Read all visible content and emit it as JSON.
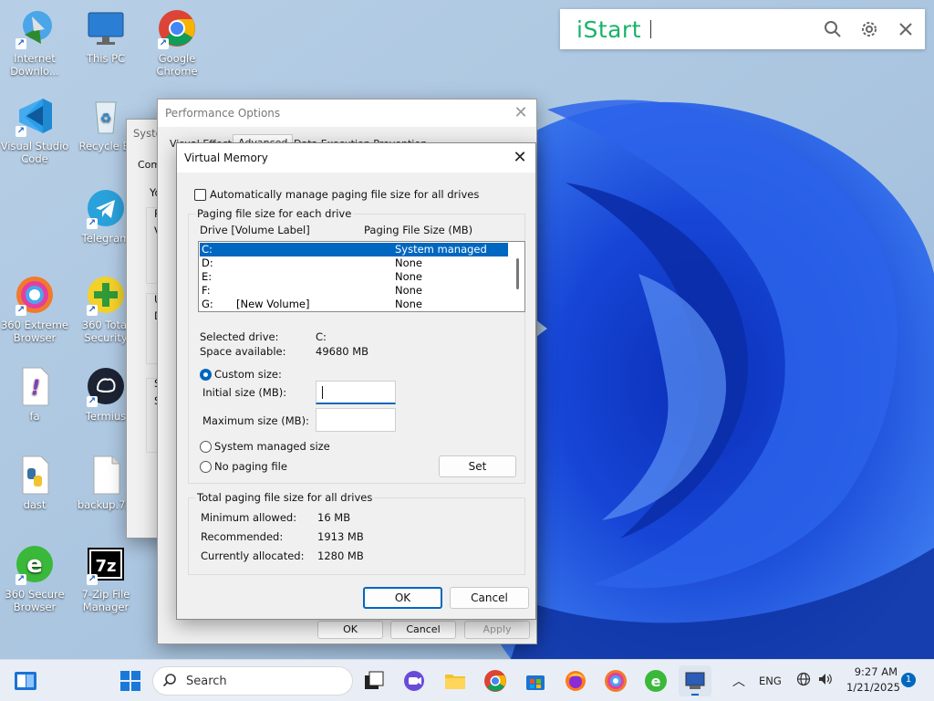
{
  "desktop": {
    "icons": [
      {
        "label": "Internet Downlo...",
        "icon": "internet-download-manager-icon"
      },
      {
        "label": "This PC",
        "icon": "this-pc-icon"
      },
      {
        "label": "Google Chrome",
        "icon": "chrome-icon"
      },
      {
        "label": "Visual Studio Code",
        "icon": "vscode-icon"
      },
      {
        "label": "Recycle Bi",
        "icon": "recycle-bin-icon"
      },
      {
        "label": "Telegram",
        "icon": "telegram-icon"
      },
      {
        "label": "360 Extreme Browser",
        "icon": "360-extreme-browser-icon"
      },
      {
        "label": "360 Total Security",
        "icon": "360-total-security-icon"
      },
      {
        "label": "fa",
        "icon": "file-icon"
      },
      {
        "label": "Termius",
        "icon": "termius-icon"
      },
      {
        "label": "dast",
        "icon": "python-file-icon"
      },
      {
        "label": "backup.7z.",
        "icon": "blank-file-icon"
      },
      {
        "label": "360 Secure Browser",
        "icon": "360-secure-browser-icon"
      },
      {
        "label": "7-Zip File Manager",
        "icon": "7zip-icon"
      }
    ]
  },
  "istart": {
    "logo": "iStart",
    "search_value": ""
  },
  "system_properties": {
    "title_fragment": "Syste",
    "tab_fragment": "Com",
    "frag1": "Yo",
    "frag2": "P",
    "frag3": "V",
    "frag4": "U",
    "frag5": "D",
    "frag6": "S",
    "frag7": "S"
  },
  "performance_options": {
    "title": "Performance Options",
    "tabs": [
      "Visual Effects",
      "Advanced",
      "Data Execution Prevention"
    ],
    "ok": "OK",
    "cancel": "Cancel",
    "apply": "Apply"
  },
  "virtual_memory": {
    "title": "Virtual Memory",
    "auto_manage_label": "Automatically manage paging file size for all drives",
    "auto_manage_checked": false,
    "group1_title": "Paging file size for each drive",
    "col_drive": "Drive  [Volume Label]",
    "col_size": "Paging File Size (MB)",
    "drives": [
      {
        "drive": "C:",
        "label": "",
        "size": "System managed",
        "selected": true
      },
      {
        "drive": "D:",
        "label": "",
        "size": "None",
        "selected": false
      },
      {
        "drive": "E:",
        "label": "",
        "size": "None",
        "selected": false
      },
      {
        "drive": "F:",
        "label": "",
        "size": "None",
        "selected": false
      },
      {
        "drive": "G:",
        "label": "[New Volume]",
        "size": "None",
        "selected": false
      }
    ],
    "selected_drive_label": "Selected drive:",
    "selected_drive_value": "C:",
    "space_available_label": "Space available:",
    "space_available_value": "49680 MB",
    "custom_size_label": "Custom size:",
    "initial_size_label": "Initial size (MB):",
    "initial_size_value": "",
    "maximum_size_label": "Maximum size (MB):",
    "maximum_size_value": "",
    "system_managed_label": "System managed size",
    "no_paging_label": "No paging file",
    "selected_option": "custom",
    "set_button": "Set",
    "group2_title": "Total paging file size for all drives",
    "min_allowed_label": "Minimum allowed:",
    "min_allowed_value": "16 MB",
    "recommended_label": "Recommended:",
    "recommended_value": "1913 MB",
    "currently_allocated_label": "Currently allocated:",
    "currently_allocated_value": "1280 MB",
    "ok": "OK",
    "cancel": "Cancel"
  },
  "taskbar": {
    "search_placeholder": "Search",
    "language": "ENG",
    "time": "9:27 AM",
    "date": "1/21/2025",
    "notification_count": "1"
  },
  "colors": {
    "accent": "#0067c0",
    "istart_green": "#19b36b",
    "wallpaper_blue": "#1a4fd8"
  }
}
